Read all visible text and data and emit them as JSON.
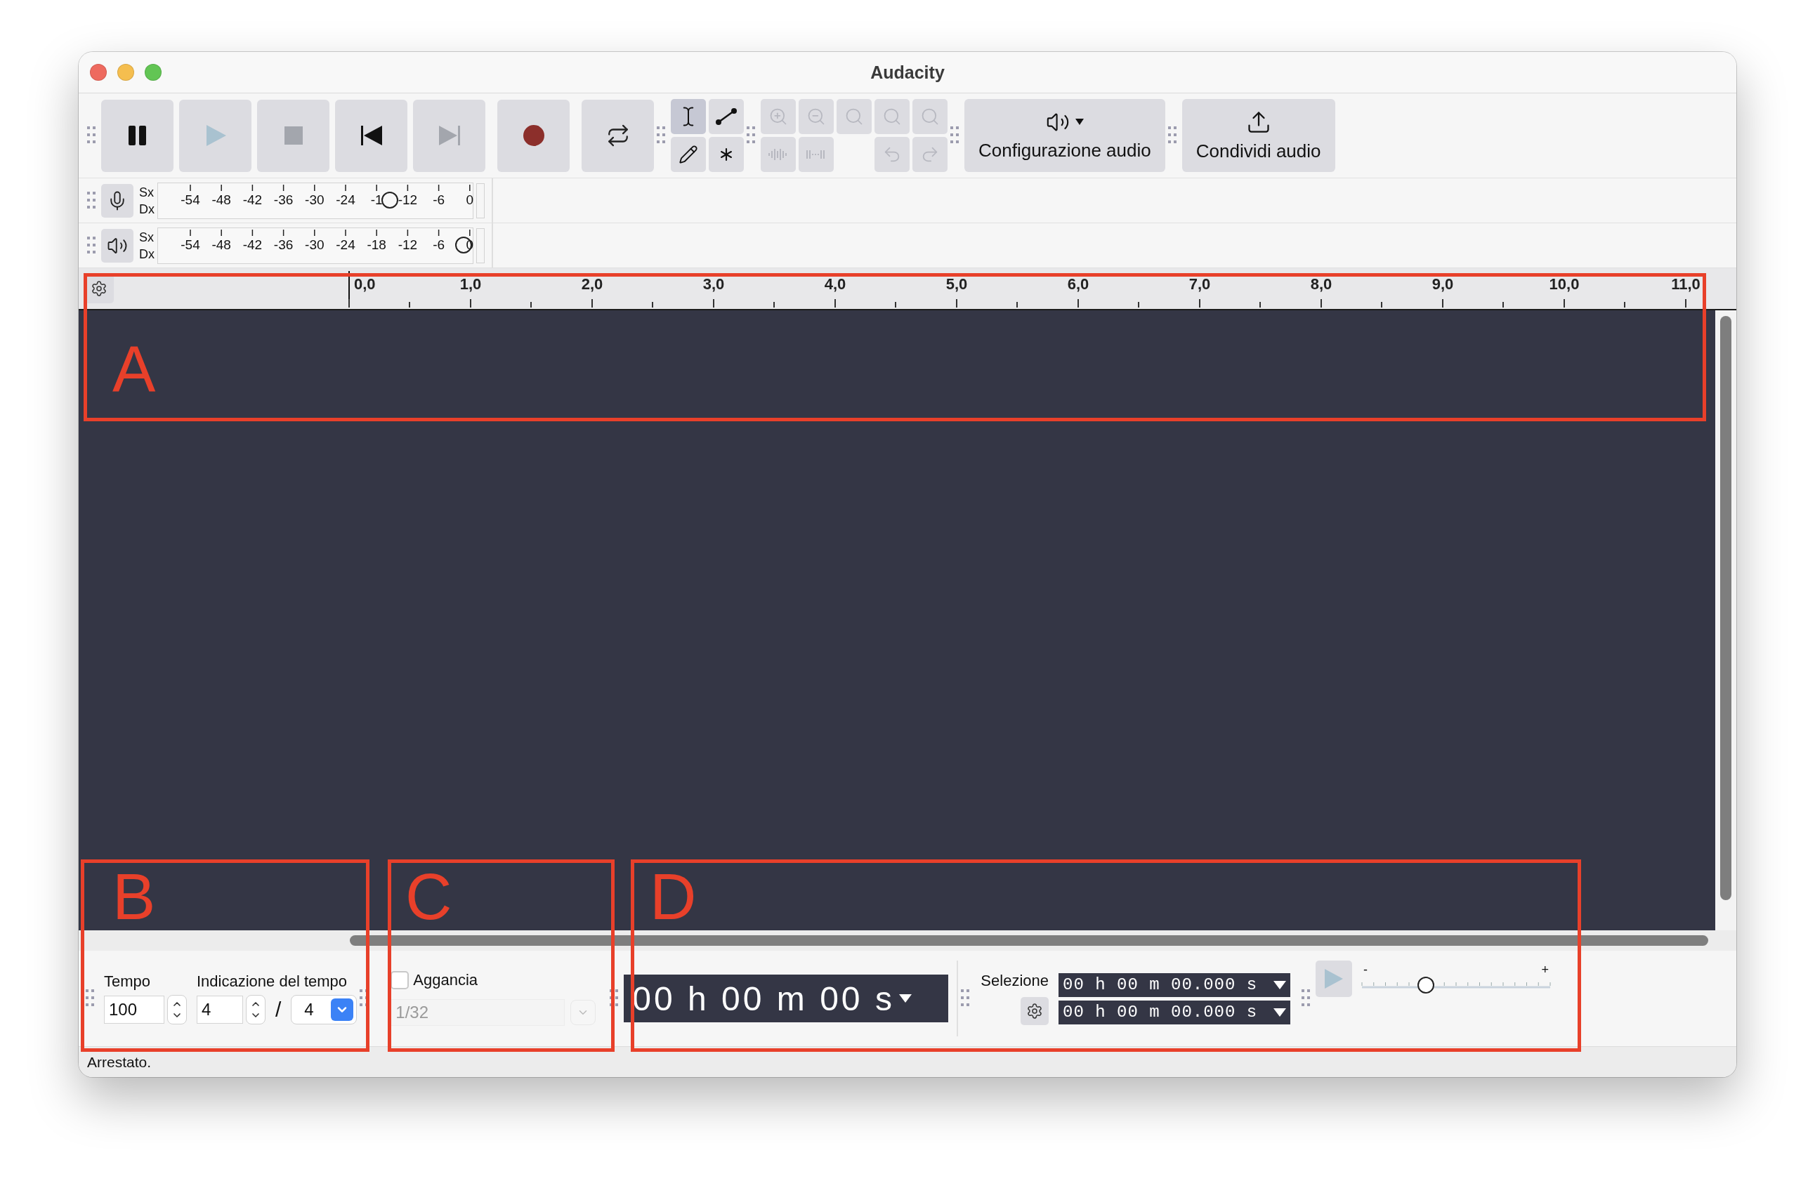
{
  "window": {
    "title": "Audacity"
  },
  "transport": [
    {
      "kind": "pause",
      "disabled": false
    },
    {
      "kind": "play",
      "disabled": true
    },
    {
      "kind": "stop",
      "disabled": true
    },
    {
      "kind": "skip_start",
      "disabled": false
    },
    {
      "kind": "skip_end",
      "disabled": true
    },
    {
      "kind": "record",
      "disabled": false
    },
    {
      "kind": "loop",
      "disabled": false
    }
  ],
  "tools": [
    {
      "kind": "select",
      "selected": true
    },
    {
      "kind": "envelope",
      "selected": false
    },
    {
      "kind": "draw",
      "selected": false
    },
    {
      "kind": "multi",
      "selected": false
    }
  ],
  "audio_setup": {
    "label": "Configurazione audio"
  },
  "share_audio": {
    "label": "Condividi audio"
  },
  "meters": [
    {
      "kind": "recording",
      "channels": [
        "Sx",
        "Dx"
      ],
      "ticks": [
        "-54",
        "-48",
        "-42",
        "-36",
        "-30",
        "-24",
        "-1",
        "-12",
        "-6",
        "0"
      ],
      "level": 0.752
    },
    {
      "kind": "playback",
      "channels": [
        "Sx",
        "Dx"
      ],
      "ticks": [
        "-54",
        "-48",
        "-42",
        "-36",
        "-30",
        "-24",
        "-18",
        "-12",
        "-6",
        "0"
      ],
      "level": 1.0
    }
  ],
  "ruler": {
    "labels": [
      "0,0",
      "1,0",
      "2,0",
      "3,0",
      "4,0",
      "5,0",
      "6,0",
      "7,0",
      "8,0",
      "9,0",
      "10,0",
      "11,0"
    ]
  },
  "tempo": {
    "label": "Tempo",
    "value": "100"
  },
  "time_signature": {
    "label": "Indicazione del tempo",
    "upper": "4",
    "separator": "/",
    "lower": "4"
  },
  "snap": {
    "label": "Aggancia",
    "checked": false,
    "value": "1/32",
    "disabled": true
  },
  "time_display": {
    "text": "00 h 00 m 00 s"
  },
  "selection": {
    "label": "Selezione",
    "start": "00 h 00 m 00.000 s",
    "end": "00 h 00 m 00.000 s"
  },
  "play_at_speed": {
    "min_label": "-",
    "max_label": "+",
    "level": 0.34
  },
  "status_bar": {
    "text": "Arrestato."
  },
  "annotations": [
    {
      "label": "A"
    },
    {
      "label": "B"
    },
    {
      "label": "C"
    },
    {
      "label": "D"
    }
  ]
}
